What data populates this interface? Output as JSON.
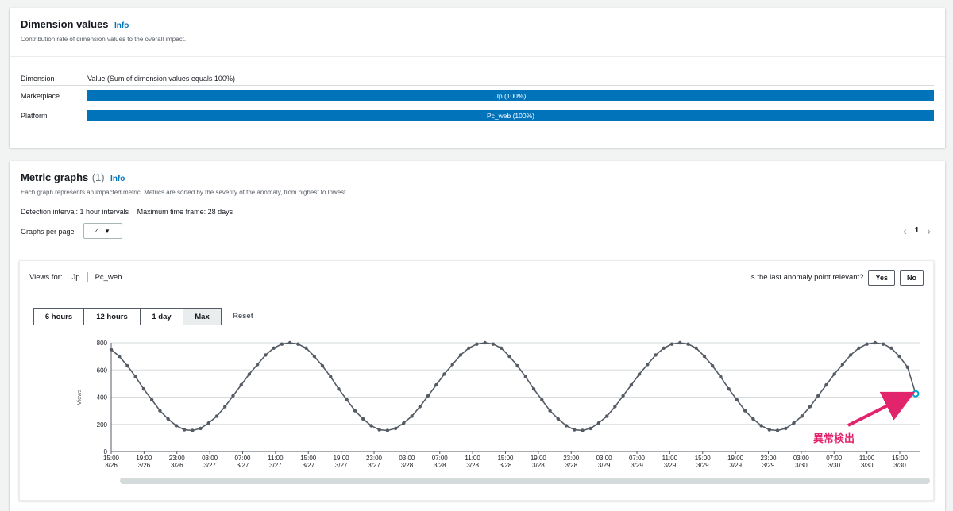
{
  "dimension_values": {
    "title": "Dimension values",
    "info": "Info",
    "description": "Contribution rate of dimension values to the overall impact.",
    "col_dimension": "Dimension",
    "col_value": "Value (Sum of dimension values equals 100%)",
    "rows": [
      {
        "dimension": "Marketplace",
        "value": "Jp (100%)",
        "share": 1.0
      },
      {
        "dimension": "Platform",
        "value": "Pc_web (100%)",
        "share": 1.0
      }
    ]
  },
  "metric_graphs": {
    "title": "Metric graphs",
    "count": "(1)",
    "info": "Info",
    "description": "Each graph represents an impacted metric. Metrics are sorted by the severity of the anomaly, from highest to lowest.",
    "detection_interval": "Detection interval: 1 hour intervals",
    "max_time_frame": "Maximum time frame: 28 days",
    "graphs_per_page_label": "Graphs per page",
    "graphs_per_page_value": "4",
    "page_number": "1"
  },
  "graph": {
    "views_for_label": "Views for:",
    "filters": [
      "Jp",
      "Pc_web"
    ],
    "relevant_question": "Is the last anomaly point relevant?",
    "yes": "Yes",
    "no": "No",
    "ranges": [
      "6 hours",
      "12 hours",
      "1 day",
      "Max"
    ],
    "active_range": "Max",
    "reset": "Reset"
  },
  "annotation": "異常検出",
  "colors": {
    "accent": "#0073bb",
    "series": "#545b64",
    "anomaly": "#00a1c9",
    "annotation": "#e2246c"
  },
  "chart_data": {
    "type": "line",
    "ylabel": "Views",
    "xlabel": "",
    "ylim": [
      0,
      800
    ],
    "yticks": [
      0,
      200,
      400,
      600,
      800
    ],
    "grid": true,
    "x_tick_labels": [
      [
        "15:00",
        "3/26"
      ],
      [
        "19:00",
        "3/26"
      ],
      [
        "23:00",
        "3/26"
      ],
      [
        "03:00",
        "3/27"
      ],
      [
        "07:00",
        "3/27"
      ],
      [
        "11:00",
        "3/27"
      ],
      [
        "15:00",
        "3/27"
      ],
      [
        "19:00",
        "3/27"
      ],
      [
        "23:00",
        "3/27"
      ],
      [
        "03:00",
        "3/28"
      ],
      [
        "07:00",
        "3/28"
      ],
      [
        "11:00",
        "3/28"
      ],
      [
        "15:00",
        "3/28"
      ],
      [
        "19:00",
        "3/28"
      ],
      [
        "23:00",
        "3/28"
      ],
      [
        "03:00",
        "3/29"
      ],
      [
        "07:00",
        "3/29"
      ],
      [
        "11:00",
        "3/29"
      ],
      [
        "15:00",
        "3/29"
      ],
      [
        "19:00",
        "3/29"
      ],
      [
        "23:00",
        "3/29"
      ],
      [
        "03:00",
        "3/30"
      ],
      [
        "07:00",
        "3/30"
      ],
      [
        "11:00",
        "3/30"
      ],
      [
        "15:00",
        "3/30"
      ]
    ],
    "series": [
      {
        "values": [
          750,
          700,
          630,
          550,
          460,
          380,
          300,
          240,
          190,
          160,
          155,
          170,
          210,
          260,
          330,
          410,
          490,
          570,
          640,
          710,
          760,
          790,
          800,
          790,
          760,
          700,
          630,
          550,
          460,
          380,
          300,
          240,
          190,
          160,
          155,
          170,
          210,
          260,
          330,
          410,
          490,
          570,
          640,
          710,
          760,
          790,
          800,
          790,
          760,
          700,
          630,
          550,
          460,
          380,
          300,
          240,
          190,
          160,
          155,
          170,
          210,
          260,
          330,
          410,
          490,
          570,
          640,
          710,
          760,
          790,
          800,
          790,
          760,
          700,
          630,
          550,
          460,
          380,
          300,
          240,
          190,
          160,
          155,
          170,
          210,
          260,
          330,
          410,
          490,
          570,
          640,
          710,
          760,
          790,
          800,
          790,
          760,
          700,
          620,
          425
        ]
      }
    ],
    "anomaly_index": 99
  }
}
